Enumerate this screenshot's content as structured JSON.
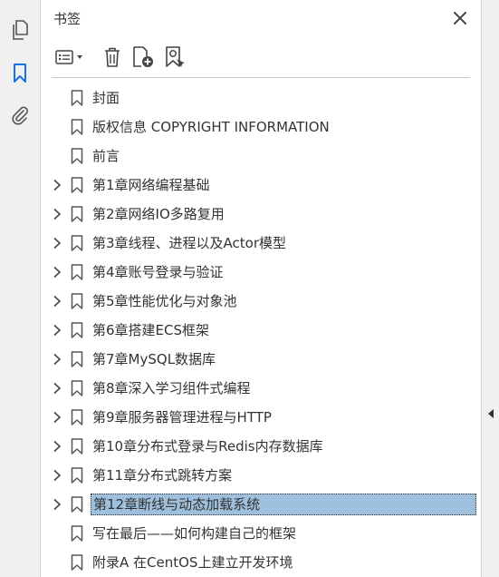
{
  "panel": {
    "title": "书签"
  },
  "rail": {
    "buttons": [
      {
        "icon": "pages-icon"
      },
      {
        "icon": "bookmark-icon",
        "active": true
      },
      {
        "icon": "attachment-icon"
      }
    ]
  },
  "toolbar": {
    "buttons": [
      {
        "icon": "options-menu-icon"
      },
      {
        "icon": "delete-icon"
      },
      {
        "icon": "new-bookmark-icon"
      },
      {
        "icon": "find-bookmark-icon"
      }
    ]
  },
  "bookmarks": [
    {
      "label": "封面",
      "expandable": false
    },
    {
      "label": "版权信息 COPYRIGHT INFORMATION",
      "expandable": false
    },
    {
      "label": "前言",
      "expandable": false
    },
    {
      "label": "第1章网络编程基础",
      "expandable": true
    },
    {
      "label": "第2章网络IO多路复用",
      "expandable": true
    },
    {
      "label": "第3章线程、进程以及Actor模型",
      "expandable": true
    },
    {
      "label": "第4章账号登录与验证",
      "expandable": true
    },
    {
      "label": "第5章性能优化与对象池",
      "expandable": true
    },
    {
      "label": "第6章搭建ECS框架",
      "expandable": true
    },
    {
      "label": "第7章MySQL数据库",
      "expandable": true
    },
    {
      "label": "第8章深入学习组件式编程",
      "expandable": true
    },
    {
      "label": "第9章服务器管理进程与HTTP",
      "expandable": true
    },
    {
      "label": "第10章分布式登录与Redis内存数据库",
      "expandable": true
    },
    {
      "label": "第11章分布式跳转方案",
      "expandable": true
    },
    {
      "label": "第12章断线与动态加载系统",
      "expandable": true,
      "selected": true
    },
    {
      "label": "写在最后——如何构建自己的框架",
      "expandable": false
    },
    {
      "label": "附录A 在CentOS上建立开发环境",
      "expandable": false
    }
  ],
  "colors": {
    "accent": "#1473e6",
    "selection": "#9ec0dc",
    "icon": "#555555"
  }
}
